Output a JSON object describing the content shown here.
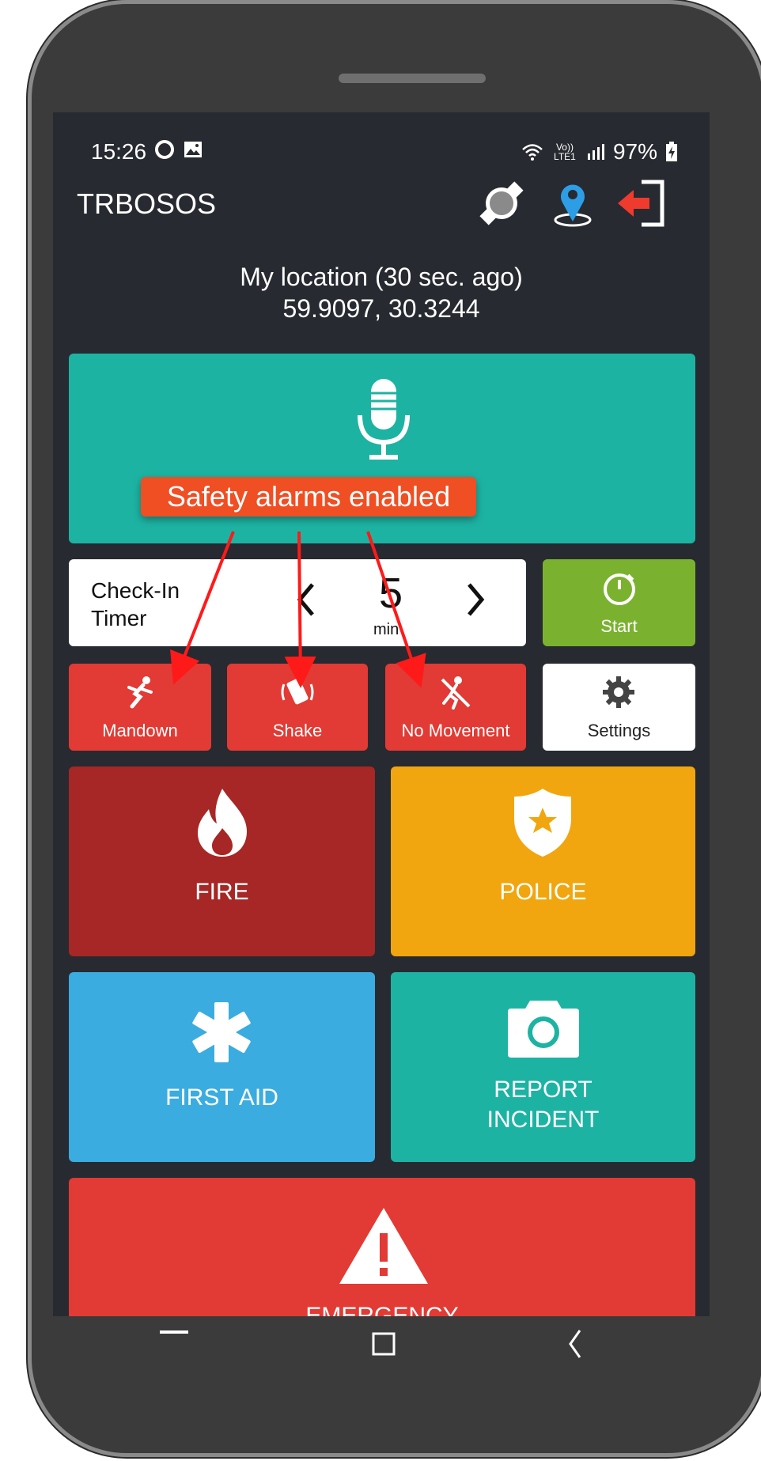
{
  "status_bar": {
    "time": "15:26",
    "network": "Vo)) LTE1",
    "battery": "97%"
  },
  "app_bar": {
    "title": "TRBOSOS",
    "icons": [
      "gps-satellite-icon",
      "location-pin-icon",
      "logout-icon"
    ]
  },
  "location": {
    "heading": "My location (30 sec. ago)",
    "coords": "59.9097, 30.3244"
  },
  "voice": {
    "icon": "microphone-icon"
  },
  "timer": {
    "label_line1": "Check-In",
    "label_line2": "Timer",
    "value": "5",
    "unit": "min",
    "start_label": "Start"
  },
  "safety": {
    "mandown_label": "Mandown",
    "shake_label": "Shake",
    "no_movement_label": "No Movement",
    "settings_label": "Settings"
  },
  "tiles": {
    "fire_label": "FIRE",
    "police_label": "POLICE",
    "first_aid_label": "FIRST AID",
    "report_line1": "REPORT",
    "report_line2": "INCIDENT",
    "emergency_label": "EMERGENCY"
  },
  "annotation": {
    "text": "Safety alarms enabled"
  },
  "colors": {
    "teal": "#1db3a3",
    "green": "#7ab22f",
    "red": "#e23a34",
    "dark_red": "#a62725",
    "amber": "#f1a60f",
    "blue": "#3aace0",
    "annotation": "#f04e23",
    "background": "#272a30"
  }
}
